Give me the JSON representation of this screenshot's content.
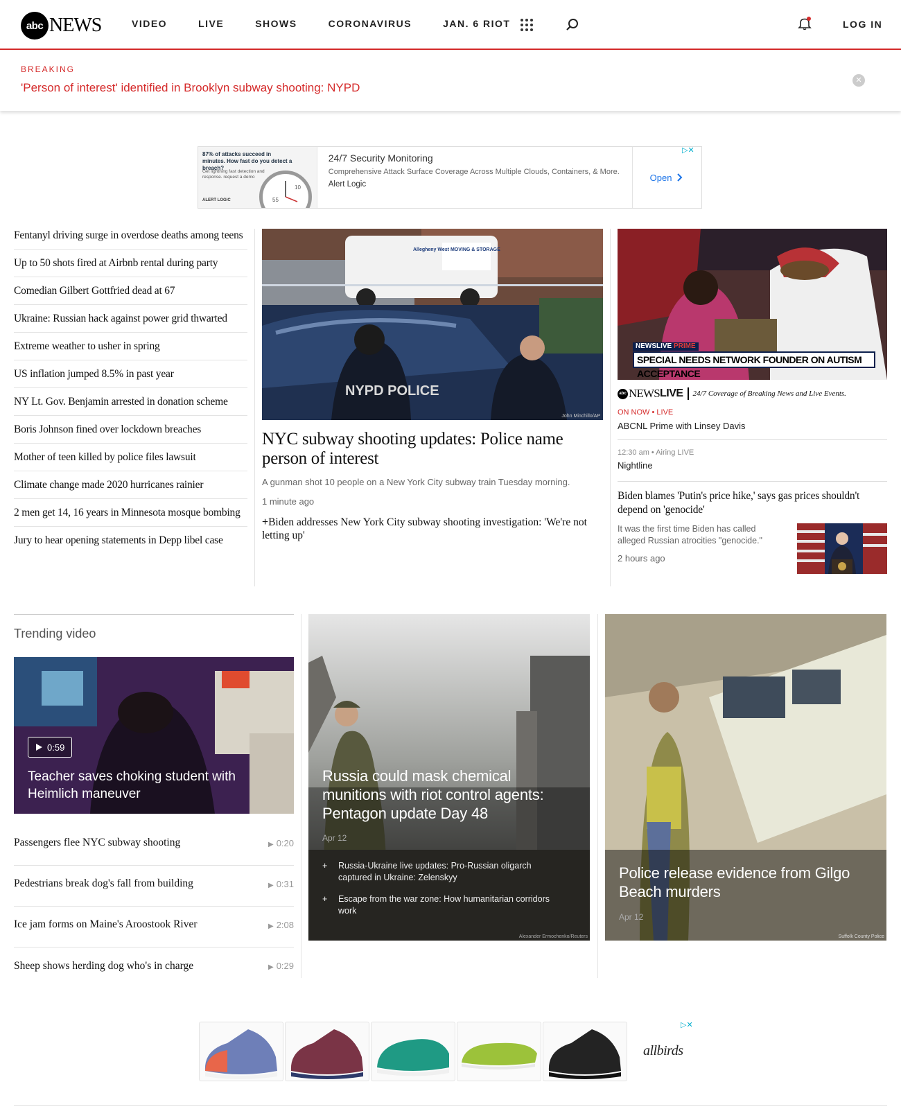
{
  "header": {
    "logo_mark": "abc",
    "logo_word": "NEWS",
    "nav": [
      "VIDEO",
      "LIVE",
      "SHOWS",
      "CORONAVIRUS",
      "JAN. 6 RIOT"
    ],
    "login": "LOG IN",
    "icons": [
      "grid-icon",
      "search-icon",
      "bell-icon"
    ],
    "accent_color": "#d52b2b"
  },
  "breaking": {
    "label": "BREAKING",
    "headline": "'Person of interest' identified in Brooklyn subway shooting: NYPD"
  },
  "ad_top": {
    "image_headline": "87% of attacks succeed in minutes. How fast do you detect a breach?",
    "image_sub": "Get lightning fast detection and response. request a demo",
    "image_brand": "ALERT LOGIC",
    "title": "24/7 Security Monitoring",
    "description": "Comprehensive Attack Surface Coverage Across Multiple Clouds, Containers, & More.",
    "advertiser": "Alert Logic",
    "cta": "Open"
  },
  "headlines": [
    "Fentanyl driving surge in overdose deaths among teens",
    "Up to 50 shots fired at Airbnb rental during party",
    "Comedian Gilbert Gottfried dead at 67",
    "Ukraine: Russian hack against power grid thwarted",
    "Extreme weather to usher in spring",
    "US inflation jumped 8.5% in past year",
    "NY Lt. Gov. Benjamin arrested in donation scheme",
    "Boris Johnson fined over lockdown breaches",
    "Mother of teen killed by police files lawsuit",
    "Climate change made 2020 hurricanes rainier",
    "2 men get 14, 16 years in Minnesota mosque bombing",
    "Jury to hear opening statements in Depp libel case"
  ],
  "lead_story": {
    "photo_credit": "John Minchillo/AP",
    "van_text": "Allegheny West MOVING & STORAGE",
    "police_label": "NYPD POLICE",
    "title": "NYC subway shooting updates: Police name person of interest",
    "description": "A gunman shot 10 people on a New York City subway train Tuesday morning.",
    "time": "1 minute ago",
    "related": "Biden addresses New York City subway shooting investigation: 'We're not letting up'"
  },
  "live": {
    "banner_top": "NEWSLIVE",
    "banner_top_accent": "PRIME",
    "banner": "SPECIAL NEEDS NETWORK FOUNDER ON AUTISM ACCEPTANCE",
    "brand_news": "NEWS",
    "brand_live": "LIVE",
    "tagline": "24/7 Coverage of Breaking News and Live Events.",
    "on_now": "ON NOW • LIVE",
    "on_now_show": "ABCNL Prime with Linsey Davis",
    "next_time": "12:30 am  •  Airing LIVE",
    "next_show": "Nightline"
  },
  "side_story": {
    "title": "Biden blames 'Putin's price hike,' says gas prices shouldn't depend on 'genocide'",
    "description": "It was the first time Biden has called alleged Russian atrocities \"genocide.\"",
    "time": "2 hours ago"
  },
  "trending": {
    "label": "Trending video",
    "feature": {
      "duration": "0:59",
      "title": "Teacher saves choking student with Heimlich maneuver"
    },
    "items": [
      {
        "title": "Passengers flee NYC subway shooting",
        "duration": "0:20"
      },
      {
        "title": "Pedestrians break dog's fall from building",
        "duration": "0:31"
      },
      {
        "title": "Ice jam forms on Maine's Aroostook River",
        "duration": "2:08"
      },
      {
        "title": "Sheep shows herding dog who's in charge",
        "duration": "0:29"
      }
    ]
  },
  "card_ukraine": {
    "title": "Russia could mask chemical munitions with riot control agents: Pentagon update Day 48",
    "date": "Apr 12",
    "related": [
      "Russia-Ukraine live updates: Pro-Russian oligarch captured in Ukraine: Zelenskyy",
      "Escape from the war zone: How humanitarian corridors work"
    ],
    "credit": "Alexander Ermochenko/Reuters"
  },
  "card_gilgo": {
    "title": "Police release evidence from Gilgo Beach murders",
    "date": "Apr 12",
    "credit": "Suffolk County Police"
  },
  "ad_bottom": {
    "brand": "allbirds"
  }
}
